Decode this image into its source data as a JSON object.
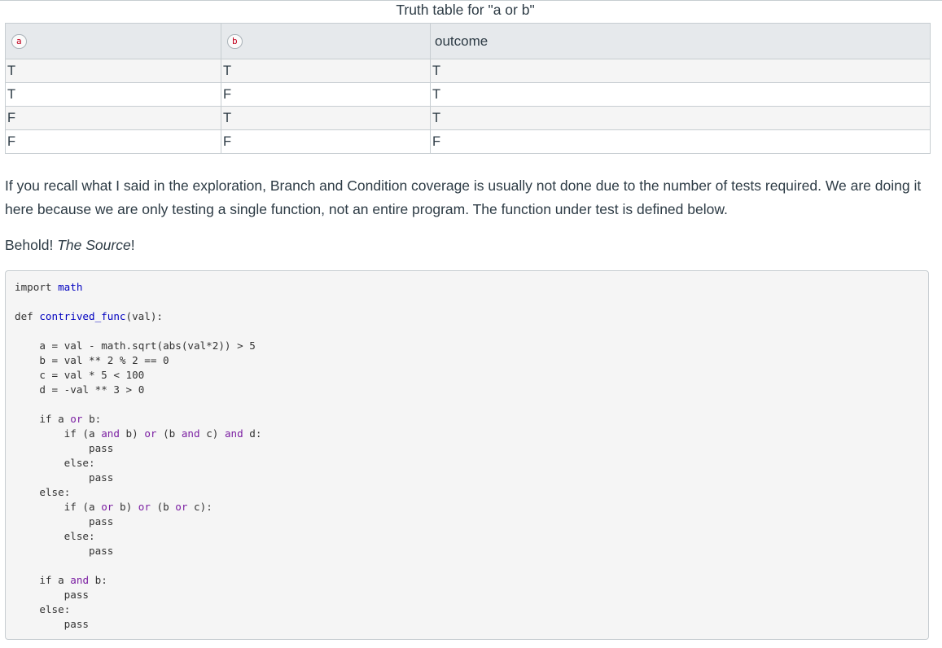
{
  "caption": "Truth table for \"a or b\"",
  "table": {
    "headers": {
      "a": "a",
      "b": "b",
      "outcome": "outcome"
    },
    "rows": [
      {
        "a": "T",
        "b": "T",
        "outcome": "T"
      },
      {
        "a": "T",
        "b": "F",
        "outcome": "T"
      },
      {
        "a": "F",
        "b": "T",
        "outcome": "T"
      },
      {
        "a": "F",
        "b": "F",
        "outcome": "F"
      }
    ]
  },
  "paragraph": "If you recall what I said in the exploration, Branch and Condition coverage is usually not done due to the number of tests required. We are doing it here because we are only testing a single function, not an entire program. The function under test is defined below.",
  "behold": {
    "prefix": "Behold! ",
    "emphasis": "The Source",
    "suffix": "!"
  },
  "code_lines": [
    "import math",
    "",
    "def contrived_func(val):",
    "",
    "    a = val - math.sqrt(abs(val*2)) > 5",
    "    b = val ** 2 % 2 == 0",
    "    c = val * 5 < 100",
    "    d = -val ** 3 > 0",
    "",
    "    if a or b:",
    "        if (a and b) or (b and c) and d:",
    "            pass",
    "        else:",
    "            pass",
    "    else:",
    "        if (a or b) or (b or c):",
    "            pass",
    "        else:",
    "            pass",
    "",
    "    if a and b:",
    "        pass",
    "    else:",
    "        pass"
  ]
}
